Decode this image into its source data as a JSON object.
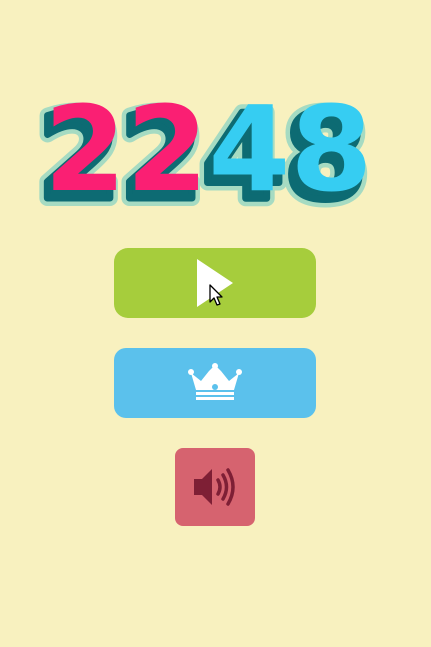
{
  "game": {
    "logo": {
      "part1": "22",
      "part2": "48"
    },
    "menu": {
      "play": {
        "icon": "play-icon"
      },
      "leaderboard": {
        "icon": "crown-icon"
      },
      "sound": {
        "icon": "speaker-icon",
        "state": "on"
      }
    }
  },
  "colors": {
    "background": "#f8f1bf",
    "logo_pink": "#fa1f73",
    "logo_cyan": "#36cdf2",
    "logo_shadow": "#0d6b73",
    "logo_outline": "#a6dbc2",
    "play_button": "#a6cd3c",
    "crown_button": "#5bc1ec",
    "sound_button": "#d6636f",
    "sound_icon": "#7e1f35",
    "icon_white": "#ffffff"
  }
}
